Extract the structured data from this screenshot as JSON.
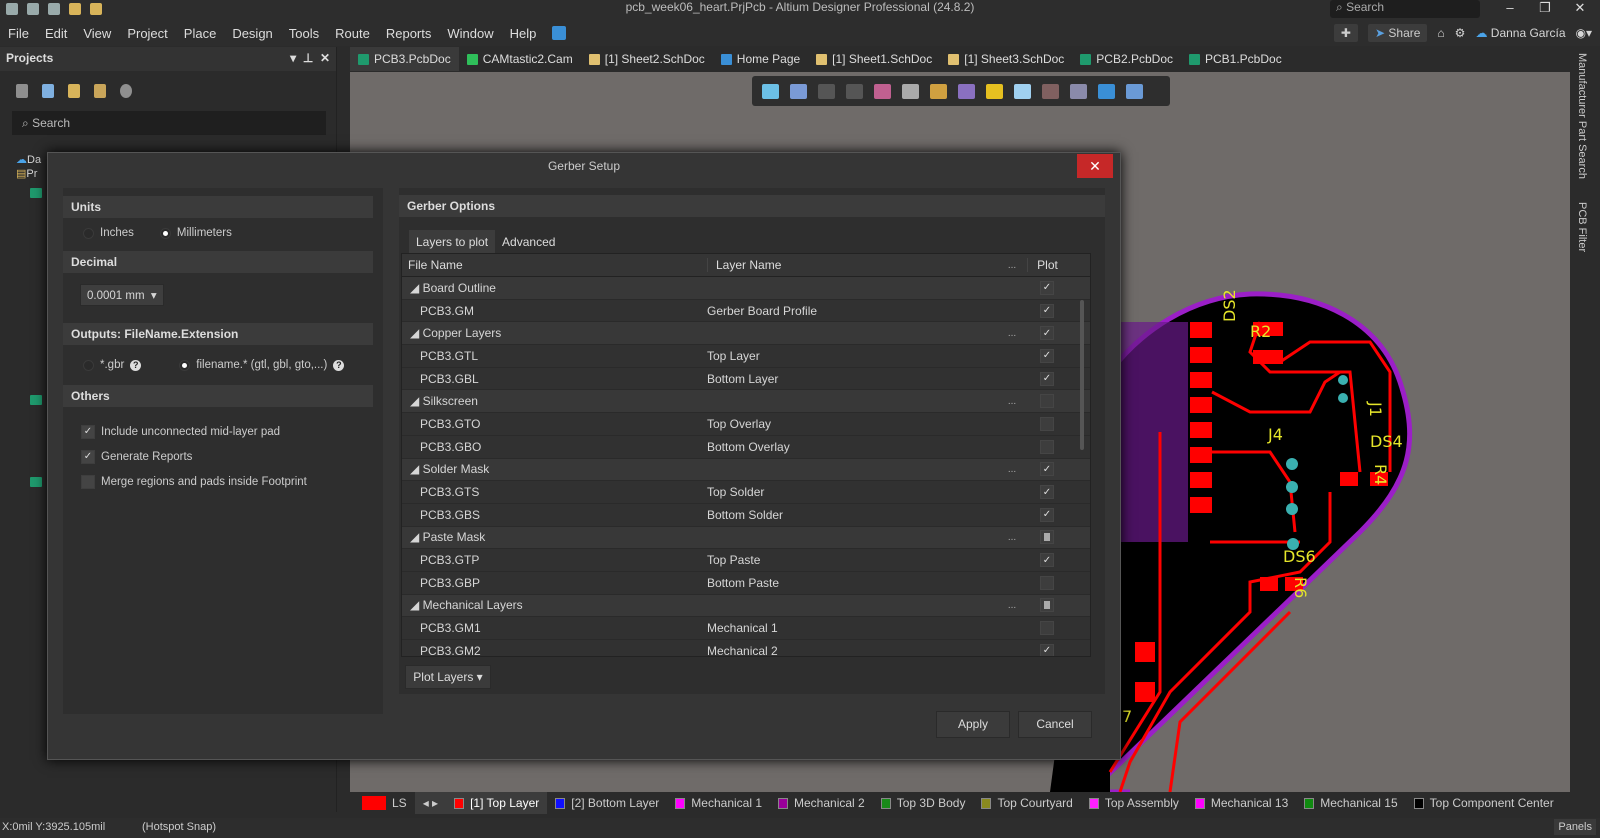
{
  "window": {
    "title": "pcb_week06_heart.PrjPcb - Altium Designer Professional (24.8.2)",
    "search_placeholder": "Search"
  },
  "menu": [
    "File",
    "Edit",
    "View",
    "Project",
    "Place",
    "Design",
    "Tools",
    "Route",
    "Reports",
    "Window",
    "Help"
  ],
  "header_right": {
    "share": "Share",
    "user": "Danna García"
  },
  "projects": {
    "title": "Projects",
    "search_placeholder": "Search",
    "tree_fragments": [
      "Da",
      "Pr"
    ]
  },
  "tabs": [
    {
      "label": "PCB3.PcbDoc",
      "icon": "pcb-icon",
      "color": "#1f9a6d",
      "active": true
    },
    {
      "label": "CAMtastic2.Cam",
      "icon": "cam-icon",
      "color": "#2fbf5a"
    },
    {
      "label": "[1] Sheet2.SchDoc",
      "icon": "schematic-icon",
      "color": "#e0c070"
    },
    {
      "label": "Home Page",
      "icon": "home-icon",
      "color": "#3a8fd6"
    },
    {
      "label": "[1] Sheet1.SchDoc",
      "icon": "schematic-icon",
      "color": "#e0c070"
    },
    {
      "label": "[1] Sheet3.SchDoc",
      "icon": "schematic-icon",
      "color": "#e0c070"
    },
    {
      "label": "PCB2.PcbDoc",
      "icon": "pcb-icon",
      "color": "#1f9a6d"
    },
    {
      "label": "PCB1.PcbDoc",
      "icon": "pcb-icon",
      "color": "#1f9a6d"
    }
  ],
  "right_sidebar": [
    "Manufacturer Part Search",
    "PCB Filter"
  ],
  "pcb_labels": [
    "DS2",
    "R2",
    "J1",
    "J4",
    "DS4",
    "R4",
    "DS6",
    "R6",
    "7"
  ],
  "dialog": {
    "title": "Gerber Setup",
    "units": {
      "header": "Units",
      "options": [
        "Inches",
        "Millimeters"
      ],
      "selected": "Millimeters"
    },
    "decimal": {
      "header": "Decimal",
      "value": "0.0001 mm"
    },
    "outputs": {
      "header": "Outputs: FileName.Extension",
      "options": [
        "*.gbr",
        "filename.* (gtl, gbl, gto,...)"
      ],
      "selected": "filename.* (gtl, gbl, gto,...)"
    },
    "others": {
      "header": "Others",
      "items": [
        {
          "label": "Include unconnected mid-layer pad",
          "checked": true
        },
        {
          "label": "Generate Reports",
          "checked": true
        },
        {
          "label": "Merge regions and pads inside Footprint",
          "checked": false
        }
      ]
    },
    "gerber_options": {
      "header": "Gerber Options",
      "tabs": [
        "Layers to plot",
        "Advanced"
      ],
      "active_tab": "Layers to plot",
      "columns": [
        "File Name",
        "Layer Name",
        "...",
        "Plot"
      ],
      "rows": [
        {
          "group": true,
          "file": "Board Outline",
          "layer": "",
          "more": "",
          "plot": "checked"
        },
        {
          "file": "PCB3.GM",
          "layer": "Gerber Board Profile",
          "plot": "checked"
        },
        {
          "group": true,
          "file": "Copper Layers",
          "layer": "",
          "more": "...",
          "plot": "checked"
        },
        {
          "file": "PCB3.GTL",
          "layer": "Top Layer",
          "plot": "checked"
        },
        {
          "file": "PCB3.GBL",
          "layer": "Bottom Layer",
          "plot": "checked"
        },
        {
          "group": true,
          "file": "Silkscreen",
          "layer": "",
          "more": "...",
          "plot": "unchecked"
        },
        {
          "file": "PCB3.GTO",
          "layer": "Top Overlay",
          "plot": "unchecked"
        },
        {
          "file": "PCB3.GBO",
          "layer": "Bottom Overlay",
          "plot": "unchecked"
        },
        {
          "group": true,
          "file": "Solder Mask",
          "layer": "",
          "more": "...",
          "plot": "checked"
        },
        {
          "file": "PCB3.GTS",
          "layer": "Top Solder",
          "plot": "checked"
        },
        {
          "file": "PCB3.GBS",
          "layer": "Bottom Solder",
          "plot": "checked"
        },
        {
          "group": true,
          "file": "Paste Mask",
          "layer": "",
          "more": "...",
          "plot": "partial"
        },
        {
          "file": "PCB3.GTP",
          "layer": "Top Paste",
          "plot": "checked"
        },
        {
          "file": "PCB3.GBP",
          "layer": "Bottom Paste",
          "plot": "unchecked"
        },
        {
          "group": true,
          "file": "Mechanical Layers",
          "layer": "",
          "more": "...",
          "plot": "partial"
        },
        {
          "file": "PCB3.GM1",
          "layer": "Mechanical 1",
          "plot": "unchecked"
        },
        {
          "file": "PCB3.GM2",
          "layer": "Mechanical 2",
          "plot": "checked"
        }
      ],
      "plot_layers_button": "Plot Layers"
    },
    "apply": "Apply",
    "cancel": "Cancel"
  },
  "layer_bar": {
    "ls": "LS",
    "layers": [
      {
        "label": "[1] Top Layer",
        "color": "#ff0000",
        "active": true
      },
      {
        "label": "[2] Bottom Layer",
        "color": "#1010ff"
      },
      {
        "label": "Mechanical 1",
        "color": "#ff00ff"
      },
      {
        "label": "Mechanical 2",
        "color": "#9a009a"
      },
      {
        "label": "Top 3D Body",
        "color": "#1a8a1a"
      },
      {
        "label": "Top Courtyard",
        "color": "#8a8a20"
      },
      {
        "label": "Top Assembly",
        "color": "#ff20ff"
      },
      {
        "label": "Mechanical 13",
        "color": "#ff00ff"
      },
      {
        "label": "Mechanical 15",
        "color": "#108a10"
      },
      {
        "label": "Top Component Center",
        "color": "#000000"
      }
    ]
  },
  "status": {
    "coords": "X:0mil Y:3925.105mil",
    "snap": "(Hotspot Snap)",
    "panels": "Panels"
  }
}
